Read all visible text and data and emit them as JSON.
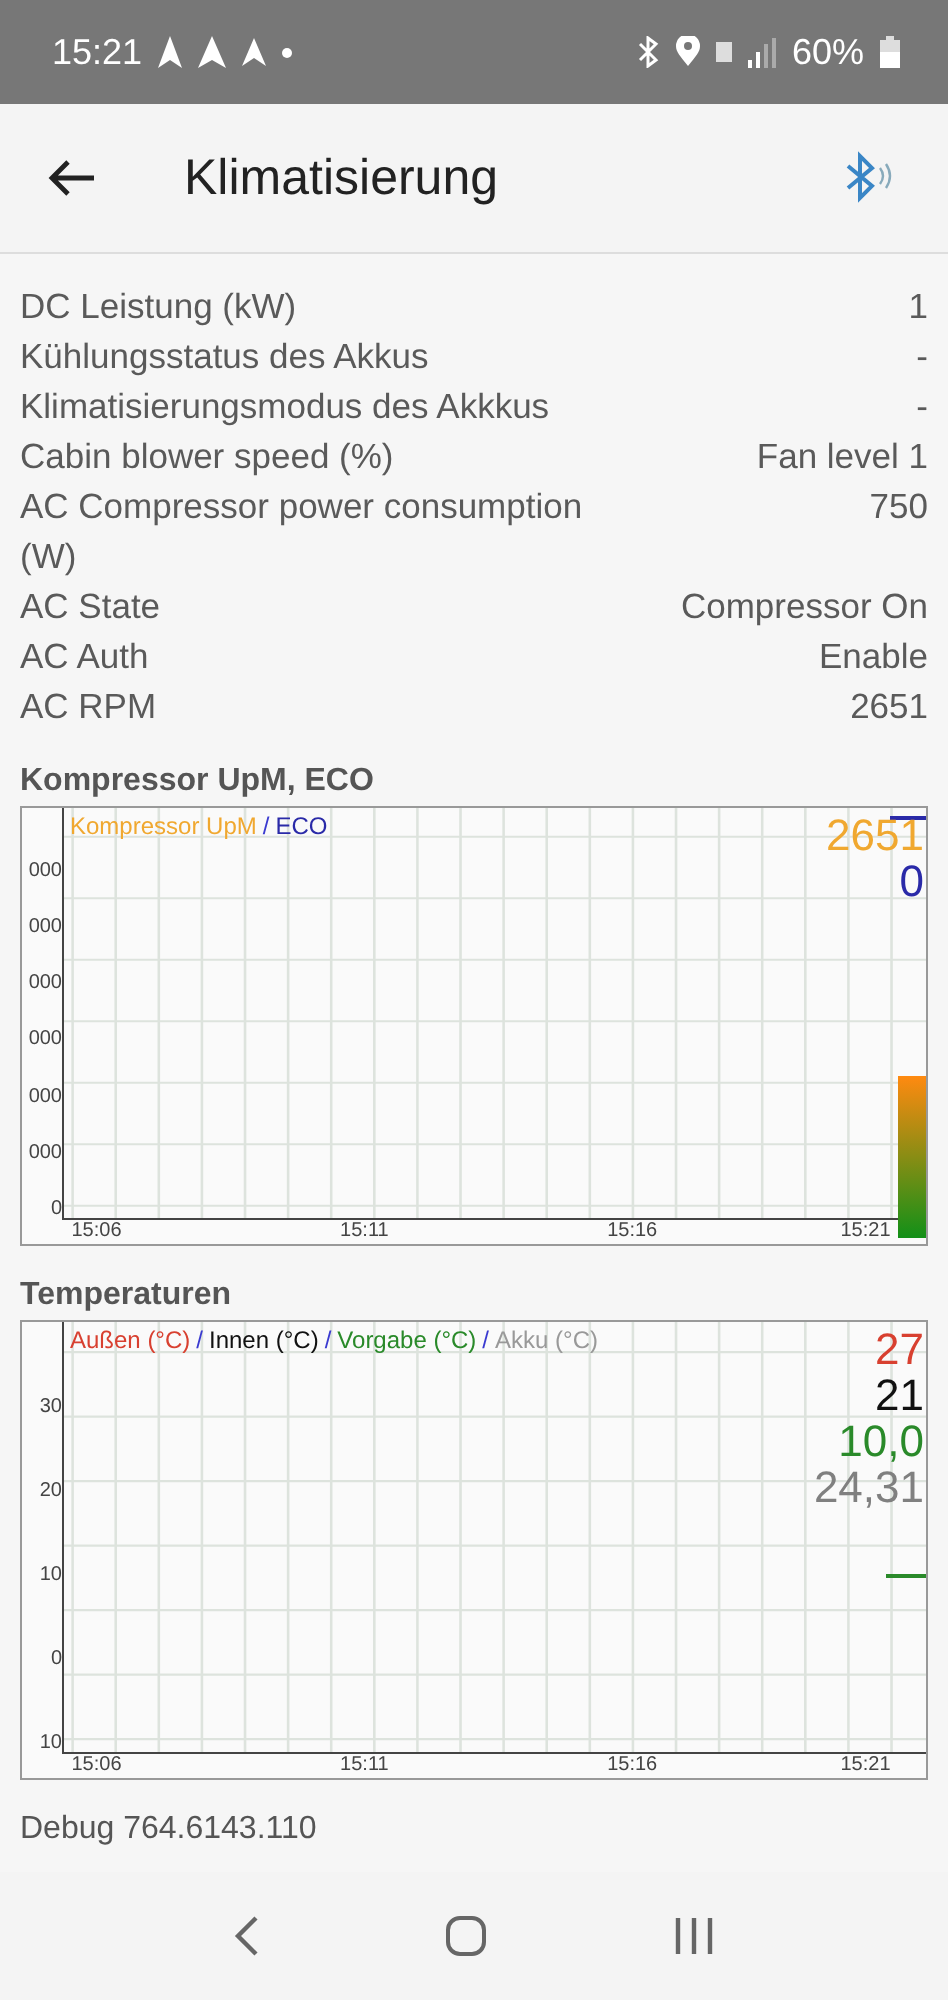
{
  "status_bar": {
    "time": "15:21",
    "battery": "60%"
  },
  "app_bar": {
    "title": "Klimatisierung"
  },
  "rows": [
    {
      "label": "DC Leistung (kW)",
      "value": "1"
    },
    {
      "label": "Kühlungsstatus des Akkus",
      "value": "-"
    },
    {
      "label": "Klimatisierungsmodus des Akkkus",
      "value": "-"
    },
    {
      "label": "Cabin blower speed (%)",
      "value": "Fan level 1"
    },
    {
      "label": "AC Compressor power consumption (W)",
      "value": "750"
    },
    {
      "label": "AC State",
      "value": "Compressor On"
    },
    {
      "label": "AC Auth",
      "value": "Enable"
    },
    {
      "label": "AC RPM",
      "value": "2651"
    }
  ],
  "charts": [
    {
      "title": "Kompressor UpM, ECO",
      "legend": [
        {
          "label": "Kompressor UpM",
          "color": "#f0a830"
        },
        {
          "separator": "/",
          "label": "ECO",
          "color": "#2a2aa8"
        }
      ],
      "readings": [
        {
          "text": "2651",
          "color": "#f0a830"
        },
        {
          "text": "0",
          "color": "#2a2aa8"
        }
      ],
      "y_tick_labels": [
        "000",
        "000",
        "000",
        "000",
        "000",
        "000",
        "0"
      ],
      "x_tick_labels": [
        "15:06",
        "15:11",
        "15:16",
        "15:21"
      ]
    },
    {
      "title": "Temperaturen",
      "legend": [
        {
          "label": "Außen (°C)",
          "color": "#d84030"
        },
        {
          "separator": "/",
          "label": "Innen (°C)",
          "color": "#111111"
        },
        {
          "separator": "/",
          "label": "Vorgabe (°C)",
          "color": "#2a8a2a"
        },
        {
          "separator": "/",
          "label": "Akku (°C)",
          "color": "#999999"
        }
      ],
      "readings": [
        {
          "text": "27",
          "color": "#d84030"
        },
        {
          "text": "21",
          "color": "#111111"
        },
        {
          "text": "10,0",
          "color": "#2a8a2a"
        },
        {
          "text": "24,31",
          "color": "#808080"
        }
      ],
      "y_tick_labels": [
        "30",
        "20",
        "10",
        "0",
        "10"
      ],
      "x_tick_labels": [
        "15:06",
        "15:11",
        "15:16",
        "15:21"
      ]
    }
  ],
  "debug": "Debug 764.6143.110"
}
